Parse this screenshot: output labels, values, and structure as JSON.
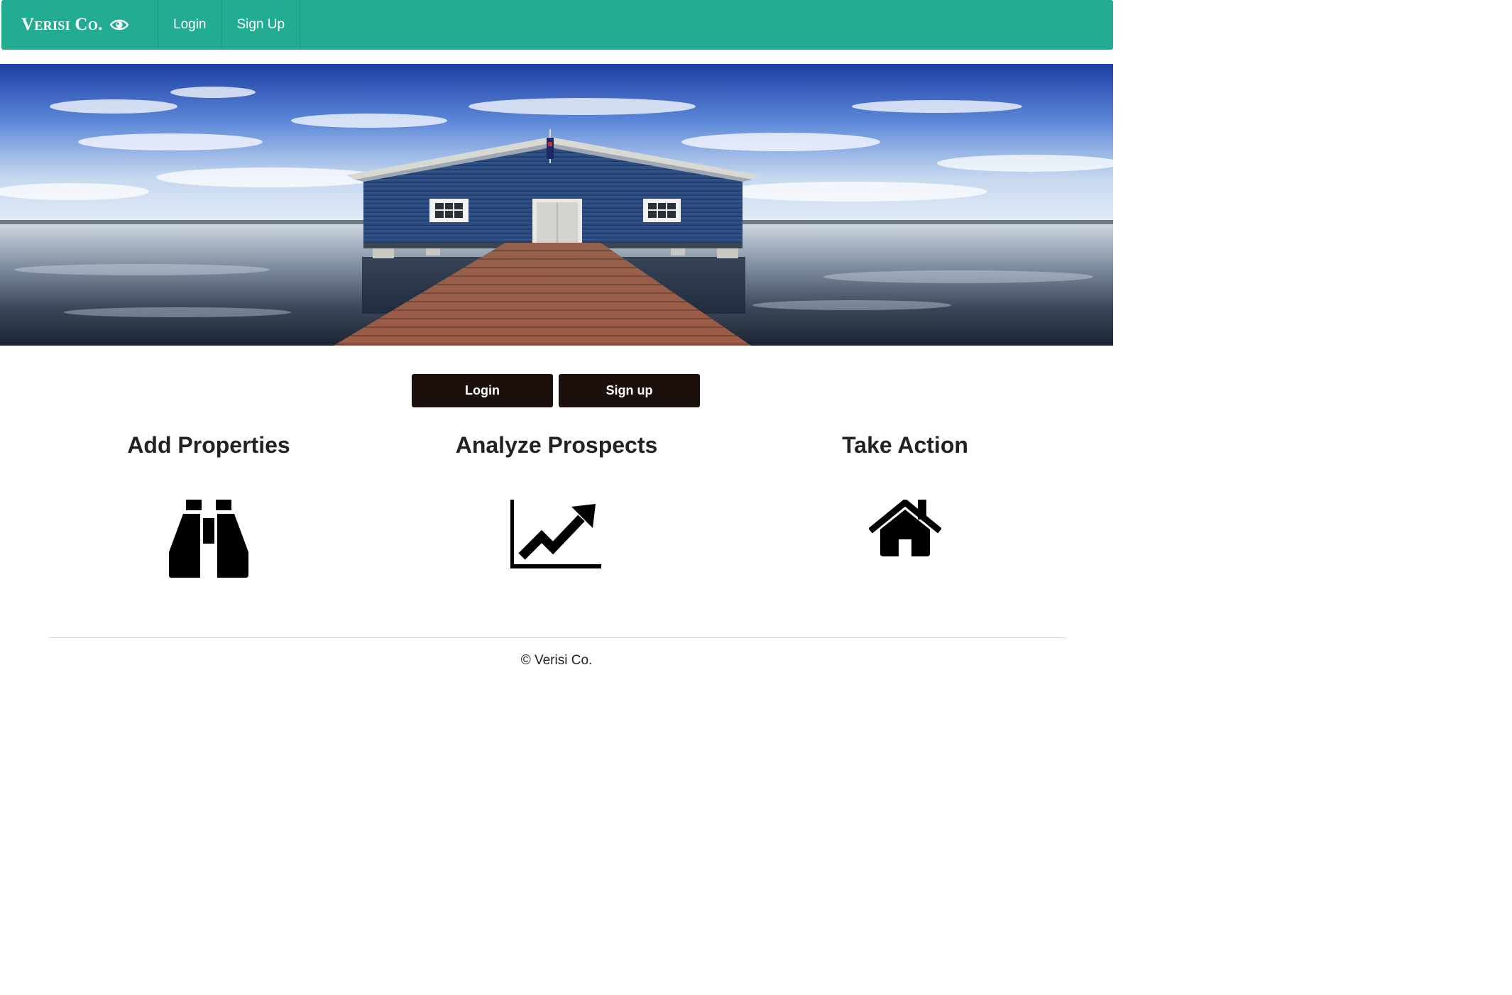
{
  "navbar": {
    "brand": "Verisi Co.",
    "brand_icon": "eye-icon",
    "links": [
      "Login",
      "Sign Up"
    ],
    "color": "#22ad92"
  },
  "hero": {
    "image": "blue boathouse on pier over calm water under cloudy sky"
  },
  "cta": {
    "login_label": "Login",
    "signup_label": "Sign up",
    "color": "#1c100d"
  },
  "features": [
    {
      "title": "Add Properties",
      "icon": "binoculars-icon"
    },
    {
      "title": "Analyze Prospects",
      "icon": "line-chart-icon"
    },
    {
      "title": "Take Action",
      "icon": "home-icon"
    }
  ],
  "footer": {
    "copyright": "© Verisi Co."
  }
}
